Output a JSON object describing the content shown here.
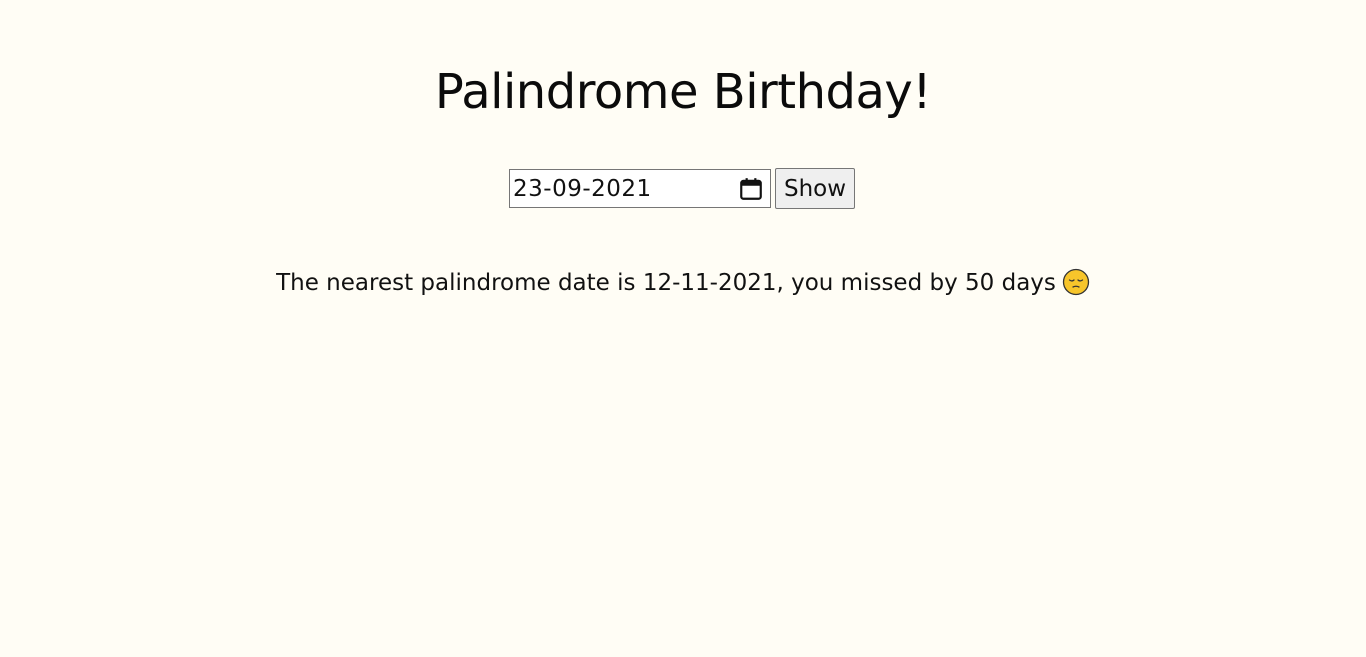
{
  "header": {
    "title": "Palindrome Birthday!"
  },
  "form": {
    "date_value": "23-09-2021",
    "show_label": "Show"
  },
  "result": {
    "message": "The nearest palindrome date is 12-11-2021, you missed by 50 days"
  },
  "icons": {
    "calendar": "calendar-icon",
    "emoji": "pensive-face-emoji"
  },
  "colors": {
    "background": "#fffdf5",
    "text": "#111111",
    "button_bg": "#efefef",
    "border": "#767676",
    "emoji_face": "#f7c52b"
  }
}
